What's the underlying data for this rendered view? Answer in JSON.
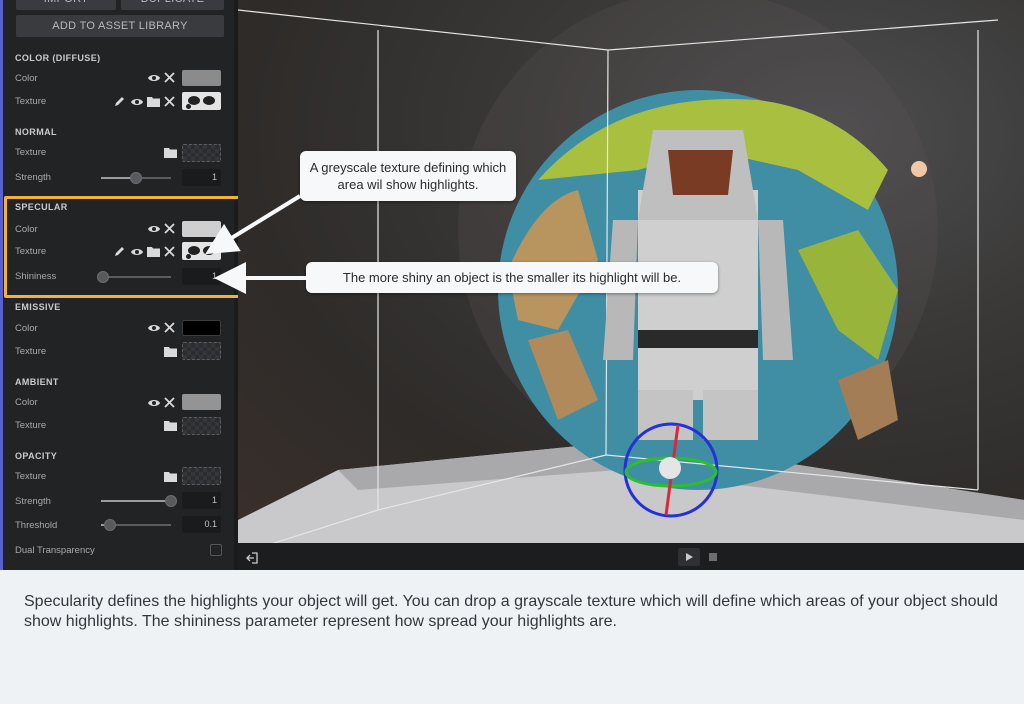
{
  "panel": {
    "buttons": {
      "import": "IMPORT",
      "duplicate": "DUPLICATE",
      "add_to_asset_library": "ADD TO ASSET LIBRARY"
    },
    "sections": {
      "color_diffuse": {
        "title": "COLOR (DIFFUSE)",
        "color_label": "Color",
        "texture_label": "Texture",
        "color": "#8b8b8b"
      },
      "normal": {
        "title": "NORMAL",
        "texture_label": "Texture",
        "strength_label": "Strength",
        "strength_value": "1",
        "strength_level": 0.5
      },
      "specular": {
        "title": "SPECULAR",
        "color_label": "Color",
        "texture_label": "Texture",
        "shininess_label": "Shininess",
        "shininess_value": "1",
        "shininess_level": 0.0,
        "color": "#cfcfcf"
      },
      "emissive": {
        "title": "EMISSIVE",
        "color_label": "Color",
        "texture_label": "Texture",
        "color": "#000000"
      },
      "ambient": {
        "title": "AMBIENT",
        "color_label": "Color",
        "texture_label": "Texture",
        "color": "#949494"
      },
      "opacity": {
        "title": "OPACITY",
        "texture_label": "Texture",
        "strength_label": "Strength",
        "strength_value": "1",
        "strength_level": 1.0,
        "threshold_label": "Threshold",
        "threshold_value": "0.1",
        "threshold_level": 0.1,
        "dual_transparency_label": "Dual Transparency",
        "dual_transparency_checked": false
      }
    },
    "highlight_color": "#f2b233",
    "accent_color": "#5a5fd1"
  },
  "icons": {
    "eye": "eye-icon",
    "close": "close-icon",
    "pencil": "pencil-icon",
    "folder": "folder-icon",
    "exit": "exit-icon",
    "play": "play-icon",
    "stop": "stop-icon"
  },
  "callouts": {
    "texture_tip": "A greyscale texture defining which area wil show highlights.",
    "shininess_tip": "The more shiny an object is the smaller its highlight will be."
  },
  "caption": "Specularity defines the highlights your object will get. You can drop a grayscale texture which will define which areas of your object should show highlights. The shininess parameter represent how spread your highlights are."
}
